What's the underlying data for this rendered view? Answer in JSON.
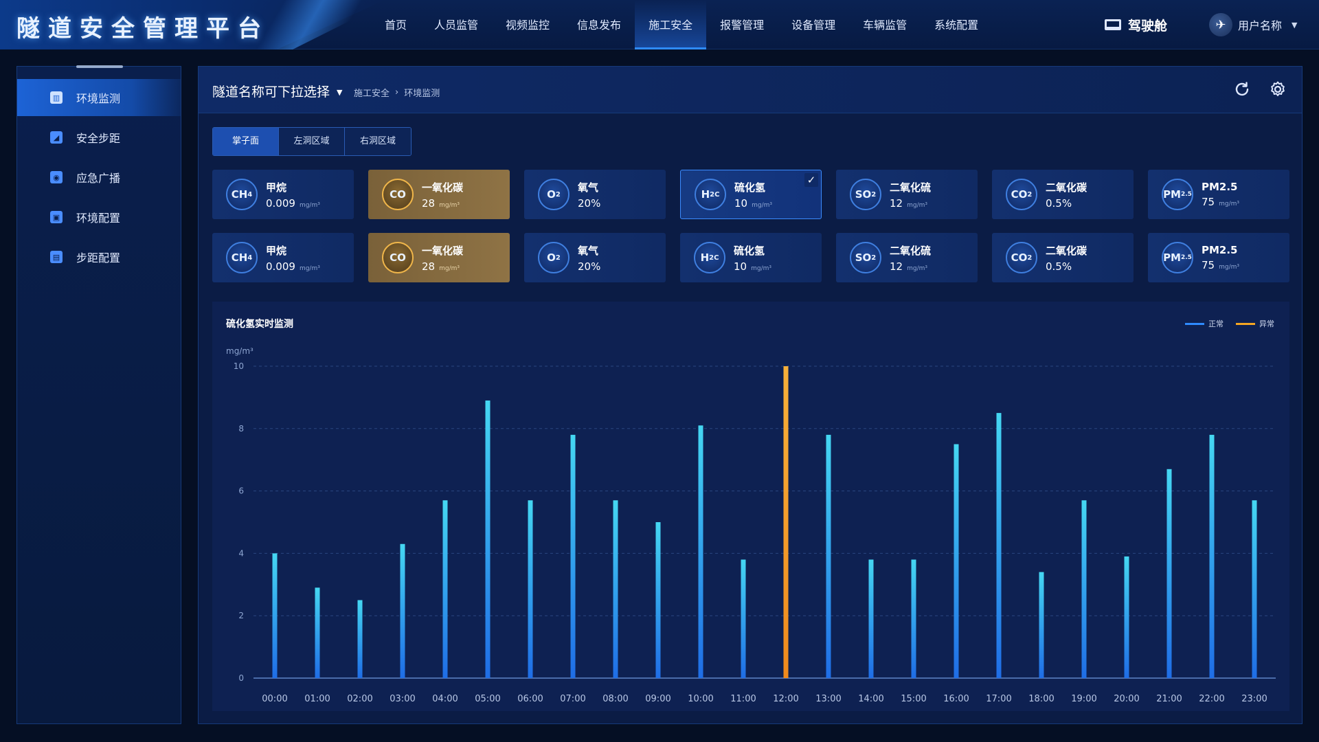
{
  "header": {
    "title": "隧道安全管理平台",
    "nav": [
      "首页",
      "人员监管",
      "视频监控",
      "信息发布",
      "施工安全",
      "报警管理",
      "设备管理",
      "车辆监管",
      "系统配置"
    ],
    "active_nav": 4,
    "cockpit_label": "驾驶舱",
    "user_name": "用户名称"
  },
  "sidebar": {
    "items": [
      {
        "label": "环境监测",
        "icon": "environment-monitor-icon"
      },
      {
        "label": "安全步距",
        "icon": "safety-distance-icon"
      },
      {
        "label": "应急广播",
        "icon": "broadcast-icon"
      },
      {
        "label": "环境配置",
        "icon": "environment-config-icon"
      },
      {
        "label": "步距配置",
        "icon": "distance-config-icon"
      }
    ],
    "active": 0
  },
  "main": {
    "tunnel_select": "隧道名称可下拉选择",
    "breadcrumb": [
      "施工安全",
      "环境监测"
    ],
    "tabs": [
      "掌子面",
      "左洞区域",
      "右洞区域"
    ],
    "active_tab": 0
  },
  "cards": [
    [
      {
        "badge": "CH4",
        "name": "甲烷",
        "value": "0.009",
        "unit": "mg/m³",
        "state": "normal"
      },
      {
        "badge": "CO",
        "name": "一氧化碳",
        "value": "28",
        "unit": "mg/m³",
        "state": "warn"
      },
      {
        "badge": "O2",
        "name": "氧气",
        "value": "20%",
        "unit": "",
        "state": "normal"
      },
      {
        "badge": "H2C",
        "name": "硫化氢",
        "value": "10",
        "unit": "mg/m³",
        "state": "selected"
      },
      {
        "badge": "SO2",
        "name": "二氧化硫",
        "value": "12",
        "unit": "mg/m³",
        "state": "normal"
      },
      {
        "badge": "CO2",
        "name": "二氧化碳",
        "value": "0.5%",
        "unit": "",
        "state": "normal"
      },
      {
        "badge": "PM2.5",
        "name": "PM2.5",
        "value": "75",
        "unit": "mg/m³",
        "state": "normal"
      }
    ],
    [
      {
        "badge": "CH4",
        "name": "甲烷",
        "value": "0.009",
        "unit": "mg/m³",
        "state": "normal"
      },
      {
        "badge": "CO",
        "name": "一氧化碳",
        "value": "28",
        "unit": "mg/m³",
        "state": "warn"
      },
      {
        "badge": "O2",
        "name": "氧气",
        "value": "20%",
        "unit": "",
        "state": "normal"
      },
      {
        "badge": "H2C",
        "name": "硫化氢",
        "value": "10",
        "unit": "mg/m³",
        "state": "normal"
      },
      {
        "badge": "SO2",
        "name": "二氧化硫",
        "value": "12",
        "unit": "mg/m³",
        "state": "normal"
      },
      {
        "badge": "CO2",
        "name": "二氧化碳",
        "value": "0.5%",
        "unit": "",
        "state": "normal"
      },
      {
        "badge": "PM2.5",
        "name": "PM2.5",
        "value": "75",
        "unit": "mg/m³",
        "state": "normal"
      }
    ]
  ],
  "chart_data": {
    "type": "bar",
    "title": "硫化氢实时监测",
    "ylabel": "mg/m³",
    "xlabel": "",
    "ylim": [
      0,
      10
    ],
    "yticks": [
      0,
      2,
      4,
      6,
      8,
      10
    ],
    "categories": [
      "00:00",
      "01:00",
      "02:00",
      "03:00",
      "04:00",
      "05:00",
      "06:00",
      "07:00",
      "08:00",
      "09:00",
      "10:00",
      "11:00",
      "12:00",
      "13:00",
      "14:00",
      "15:00",
      "16:00",
      "17:00",
      "18:00",
      "19:00",
      "20:00",
      "21:00",
      "22:00",
      "23:00"
    ],
    "values": [
      4.0,
      2.9,
      2.5,
      4.3,
      5.7,
      8.9,
      5.7,
      7.8,
      5.7,
      5.0,
      8.1,
      3.8,
      10.0,
      7.8,
      3.8,
      3.8,
      7.5,
      8.5,
      3.4,
      5.7,
      3.9,
      6.7,
      7.8,
      5.7
    ],
    "status": [
      "正常",
      "正常",
      "正常",
      "正常",
      "正常",
      "正常",
      "正常",
      "正常",
      "正常",
      "正常",
      "正常",
      "正常",
      "异常",
      "正常",
      "正常",
      "正常",
      "正常",
      "正常",
      "正常",
      "正常",
      "正常",
      "正常",
      "正常",
      "正常"
    ],
    "legend": [
      {
        "name": "正常",
        "color": "#2f8bff"
      },
      {
        "name": "异常",
        "color": "#f5a623"
      }
    ],
    "legend_position": "top-right",
    "grid": true
  }
}
